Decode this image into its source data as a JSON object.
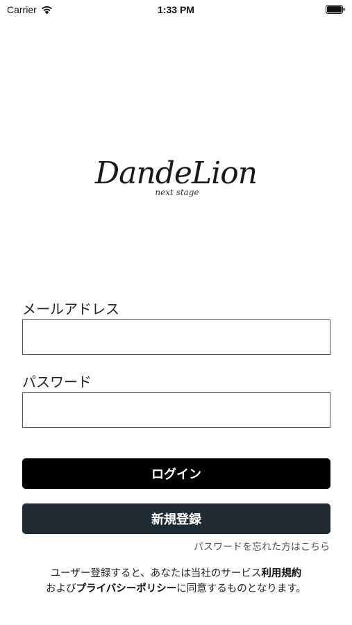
{
  "status_bar": {
    "carrier": "Carrier",
    "time": "1:33 PM",
    "wifi_icon": "wifi-icon",
    "battery_icon": "battery-icon"
  },
  "logo": {
    "wordmark": "DandeLion",
    "tagline": "next stage"
  },
  "form": {
    "email_label": "メールアドレス",
    "email_value": "",
    "password_label": "パスワード",
    "password_value": ""
  },
  "buttons": {
    "login_label": "ログイン",
    "register_label": "新規登録"
  },
  "forgot_password": "パスワードを忘れた方はこちら",
  "terms": {
    "line1_prefix": "ユーザー登録すると、あなたは当社のサービス",
    "terms_link": "利用規約",
    "line2_prefix": "および",
    "privacy_link": "プライバシーポリシー",
    "line2_suffix": "に同意するものとなります。"
  },
  "colors": {
    "login_button": "#000000",
    "register_button": "#1f2a33"
  }
}
